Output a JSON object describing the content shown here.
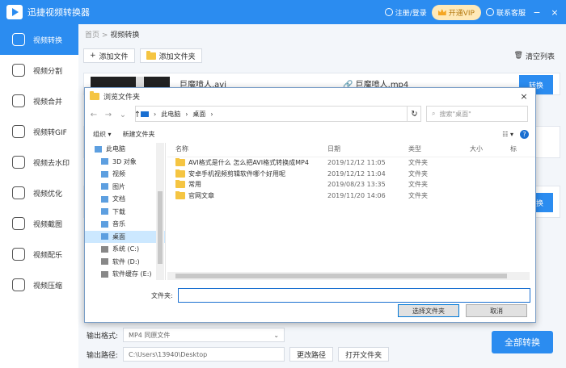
{
  "app": {
    "title": "迅捷视频转换器",
    "login": "注册/登录",
    "vip": "开通VIP",
    "service": "联系客服",
    "min_icon": "−",
    "close_icon": "×"
  },
  "sidebar": {
    "items": [
      {
        "label": "视频转换",
        "icon": "video-convert-icon"
      },
      {
        "label": "视频分割",
        "icon": "split-icon"
      },
      {
        "label": "视频合并",
        "icon": "merge-icon"
      },
      {
        "label": "视频转GIF",
        "icon": "gif-icon"
      },
      {
        "label": "视频去水印",
        "icon": "watermark-icon"
      },
      {
        "label": "视频优化",
        "icon": "optimize-icon"
      },
      {
        "label": "视频截图",
        "icon": "screenshot-icon"
      },
      {
        "label": "视频配乐",
        "icon": "music-icon"
      },
      {
        "label": "视频压缩",
        "icon": "compress-icon"
      }
    ]
  },
  "breadcrumb": {
    "home": "首页",
    "sep": ">",
    "current": "视频转换"
  },
  "toolbar": {
    "add_file": "添加文件",
    "add_folder": "添加文件夹",
    "clear": "清空列表"
  },
  "file_card": {
    "source": "巨魔喷人.avi",
    "target": "巨魔喷人.mp4",
    "convert_button": "转换"
  },
  "bottom": {
    "format_label": "输出格式:",
    "format_value": "MP4  同原文件",
    "path_label": "输出路径:",
    "path_value": "C:\\Users\\13940\\Desktop",
    "change_path": "更改路径",
    "open_folder": "打开文件夹",
    "convert_all": "全部转换"
  },
  "dialog": {
    "title": "浏览文件夹",
    "address": [
      "此电脑",
      "桌面"
    ],
    "search_placeholder": "搜索\"桌面\"",
    "organize": "组织 ▾",
    "new_folder": "新建文件夹",
    "tree": [
      {
        "label": "此电脑",
        "icon": "computer-icon",
        "top": true
      },
      {
        "label": "3D 对象",
        "icon": "3d-objects-icon"
      },
      {
        "label": "视频",
        "icon": "videos-icon"
      },
      {
        "label": "图片",
        "icon": "pictures-icon"
      },
      {
        "label": "文档",
        "icon": "documents-icon"
      },
      {
        "label": "下载",
        "icon": "download-icon"
      },
      {
        "label": "音乐",
        "icon": "music-note-icon"
      },
      {
        "label": "桌面",
        "icon": "desktop-icon",
        "selected": true
      },
      {
        "label": "系统 (C:)",
        "icon": "drive-icon"
      },
      {
        "label": "软件 (D:)",
        "icon": "drive-icon"
      },
      {
        "label": "软件缓存 (E:)",
        "icon": "drive-icon"
      }
    ],
    "columns": {
      "name": "名称",
      "date": "日期",
      "type": "类型",
      "size": "大小",
      "tail": "标"
    },
    "files": [
      {
        "name": "AVI格式是什么 怎么把AVI格式转换成MP4",
        "date": "2019/12/12 11:05",
        "type": "文件夹"
      },
      {
        "name": "安卓手机视频剪辑软件哪个好用呢",
        "date": "2019/12/12 11:04",
        "type": "文件夹"
      },
      {
        "name": "常用",
        "date": "2019/08/23 13:35",
        "type": "文件夹"
      },
      {
        "name": "官网文章",
        "date": "2019/11/20 14:06",
        "type": "文件夹"
      }
    ],
    "filename_label": "文件夹:",
    "filename_value": "",
    "select_button": "选择文件夹",
    "cancel_button": "取消"
  },
  "colors": {
    "accent": "#2b8cf0",
    "vip_bg": "#ffe9b8",
    "folder": "#f5c542"
  }
}
